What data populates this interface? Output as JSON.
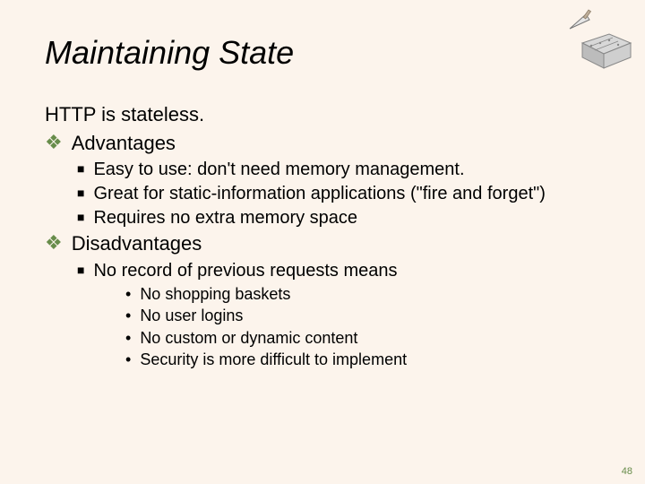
{
  "title": "Maintaining State",
  "statement": "HTTP is stateless.",
  "advantages": {
    "label": "Advantages",
    "items": [
      "Easy to use: don't need memory management.",
      "Great for static-information applications (\"fire and forget\")",
      "Requires no extra memory space"
    ]
  },
  "disadvantages": {
    "label": "Disadvantages",
    "intro": "No record of previous requests means",
    "items": [
      "No shopping baskets",
      "No user logins",
      "No custom or dynamic content",
      "Security is more difficult to implement"
    ]
  },
  "page_number": "48"
}
